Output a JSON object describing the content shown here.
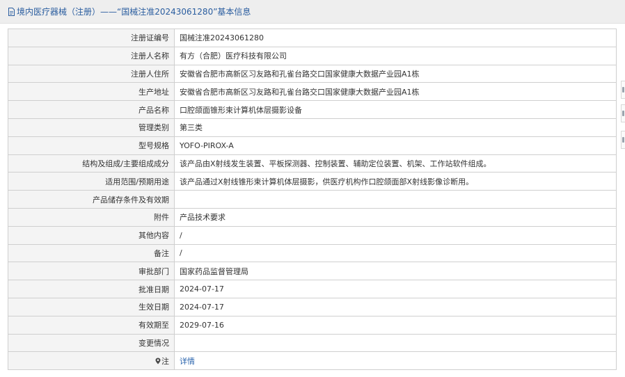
{
  "header": {
    "title": "境内医疗器械（注册）——“国械注准20243061280”基本信息"
  },
  "rows": [
    {
      "label": "注册证编号",
      "value": "国械注准20243061280"
    },
    {
      "label": "注册人名称",
      "value": "有方（合肥）医疗科技有限公司"
    },
    {
      "label": "注册人住所",
      "value": "安徽省合肥市高新区习友路和孔雀台路交口国家健康大数据产业园A1栋"
    },
    {
      "label": "生产地址",
      "value": "安徽省合肥市高新区习友路和孔雀台路交口国家健康大数据产业园A1栋"
    },
    {
      "label": "产品名称",
      "value": "口腔颌面锥形束计算机体层摄影设备"
    },
    {
      "label": "管理类别",
      "value": "第三类"
    },
    {
      "label": "型号规格",
      "value": "YOFO-PIROX-A"
    },
    {
      "label": "结构及组成/主要组成成分",
      "value": "该产品由X射线发生装置、平板探测器、控制装置、辅助定位装置、机架、工作站软件组成。"
    },
    {
      "label": "适用范围/预期用途",
      "value": "该产品通过X射线锥形束计算机体层摄影，供医疗机构作口腔颌面部X射线影像诊断用。"
    },
    {
      "label": "产品储存条件及有效期",
      "value": ""
    },
    {
      "label": "附件",
      "value": "产品技术要求"
    },
    {
      "label": "其他内容",
      "value": "/"
    },
    {
      "label": "备注",
      "value": "/"
    },
    {
      "label": "审批部门",
      "value": "国家药品监督管理局"
    },
    {
      "label": "批准日期",
      "value": "2024-07-17"
    },
    {
      "label": "生效日期",
      "value": "2024-07-17"
    },
    {
      "label": "有效期至",
      "value": "2029-07-16"
    },
    {
      "label": "变更情况",
      "value": ""
    }
  ],
  "note_row": {
    "label": "注",
    "link": "详情",
    "icon": "pin-icon"
  },
  "colors": {
    "title_text": "#2a5d9f",
    "link": "#2a64ad",
    "label_bg": "#f4f4f4",
    "border": "#cfcfcf"
  }
}
